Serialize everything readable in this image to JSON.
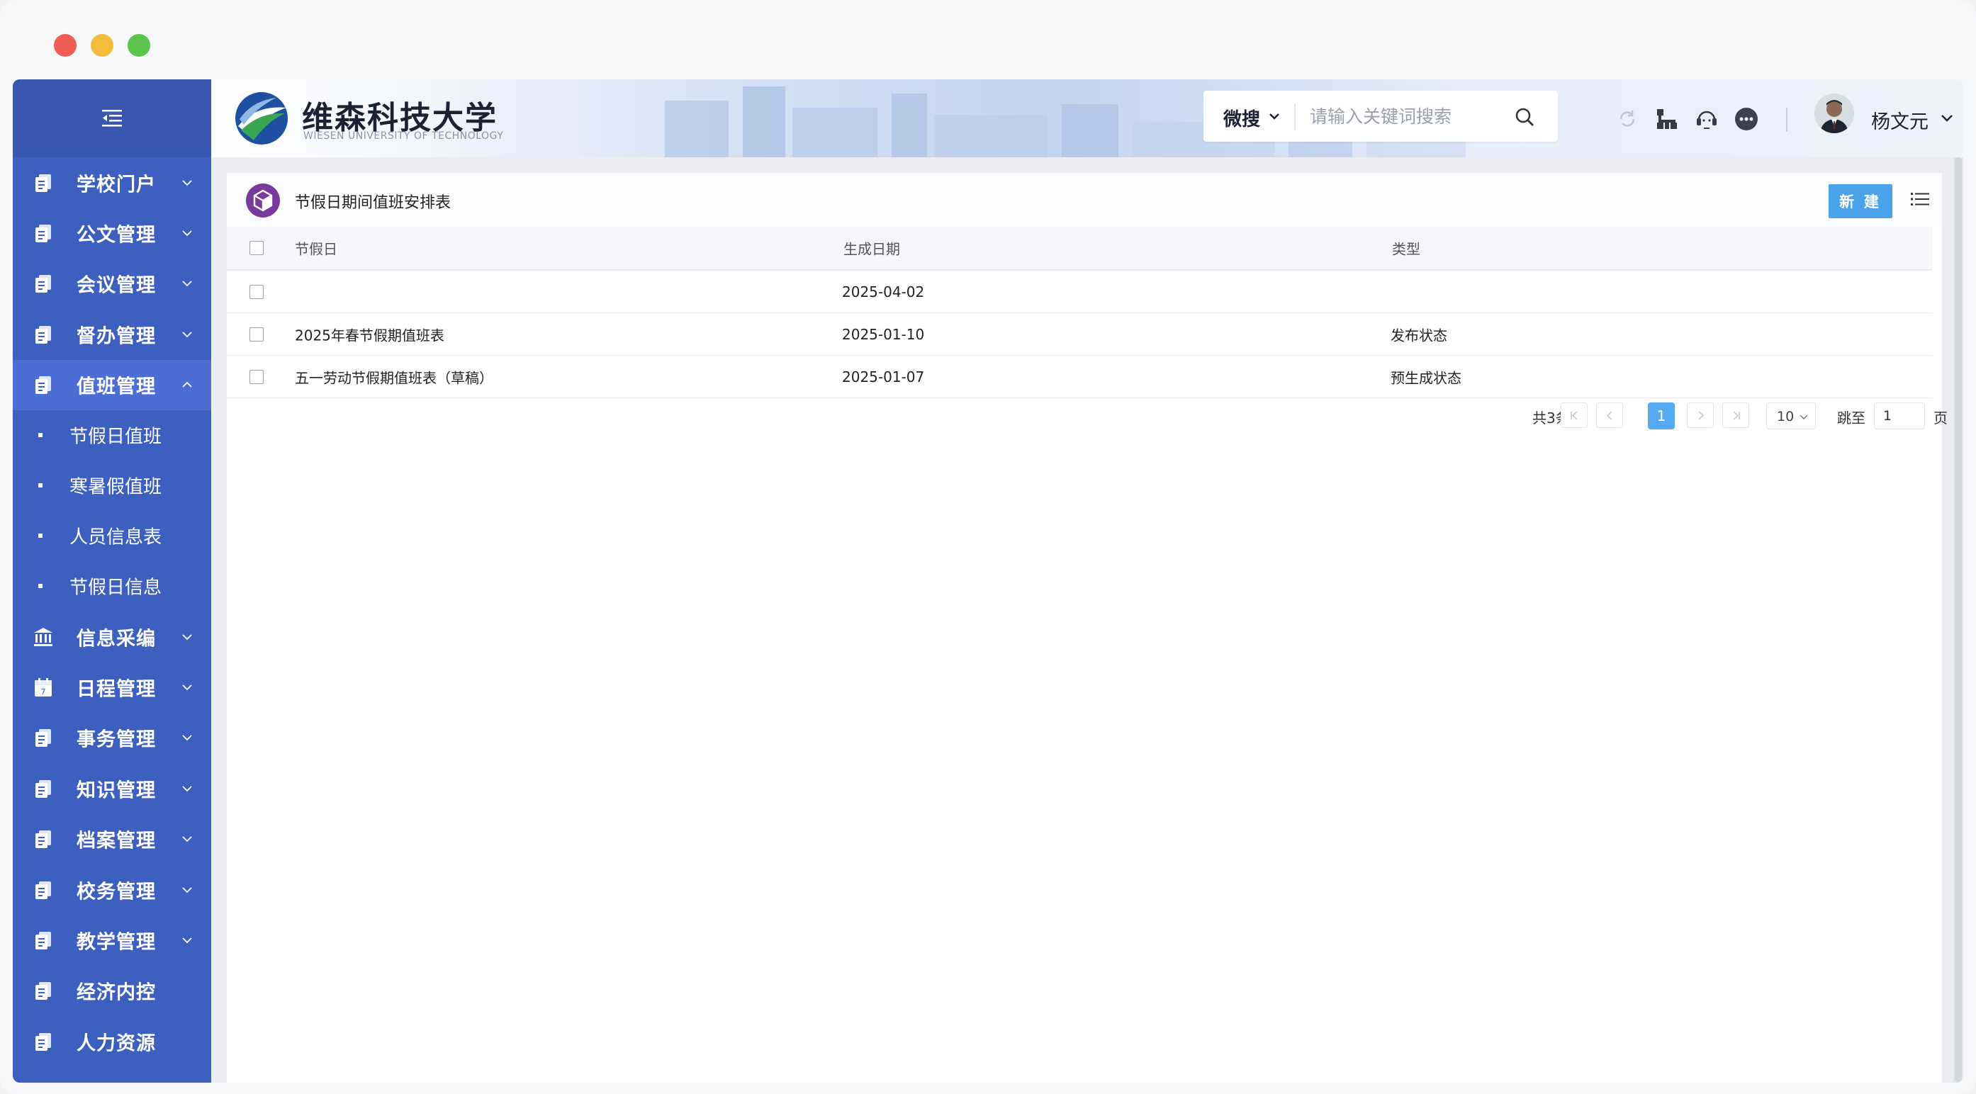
{
  "sidebar": {
    "collapse_icon": "menu-fold-icon",
    "items": [
      {
        "label": "学校门户",
        "icon": "document-icon",
        "expanded": false
      },
      {
        "label": "公文管理",
        "icon": "document-icon",
        "expanded": false
      },
      {
        "label": "会议管理",
        "icon": "document-icon",
        "expanded": false
      },
      {
        "label": "督办管理",
        "icon": "document-icon",
        "expanded": false
      },
      {
        "label": "值班管理",
        "icon": "document-icon",
        "expanded": true,
        "children": [
          "节假日值班",
          "寒暑假值班",
          "人员信息表",
          "节假日信息"
        ]
      },
      {
        "label": "信息采编",
        "icon": "bank-icon",
        "expanded": false
      },
      {
        "label": "日程管理",
        "icon": "calendar-icon",
        "expanded": false
      },
      {
        "label": "事务管理",
        "icon": "document-icon",
        "expanded": false
      },
      {
        "label": "知识管理",
        "icon": "document-icon",
        "expanded": false
      },
      {
        "label": "档案管理",
        "icon": "document-icon",
        "expanded": false
      },
      {
        "label": "校务管理",
        "icon": "document-icon",
        "expanded": false
      },
      {
        "label": "教学管理",
        "icon": "document-icon",
        "expanded": false
      },
      {
        "label": "经济内控",
        "icon": "document-icon",
        "expanded": false
      },
      {
        "label": "人力资源",
        "icon": "document-icon",
        "expanded": false
      }
    ]
  },
  "header": {
    "brand_cn": "维森科技大学",
    "brand_en": "WIESEN UNIVERSITY OF TECHNOLOGY",
    "search_scope": "微搜",
    "search_placeholder": "请输入关键词搜索",
    "user_name": "杨文元",
    "icons": [
      "refresh-icon",
      "org-chart-icon",
      "support-icon",
      "more-icon"
    ]
  },
  "panel": {
    "title": "节假日期间值班安排表",
    "new_button": "新 建",
    "columns": [
      "节假日",
      "生成日期",
      "类型"
    ],
    "rows": [
      {
        "name": "",
        "date": "2025-04-02",
        "type": ""
      },
      {
        "name": "2025年春节假期值班表",
        "date": "2025-01-10",
        "type": "发布状态"
      },
      {
        "name": "五一劳动节假期值班表（草稿）",
        "date": "2025-01-07",
        "type": "预生成状态"
      }
    ]
  },
  "pagination": {
    "total": "共3条",
    "current_page": "1",
    "page_size": "10",
    "jump_label": "跳至",
    "jump_value": "1",
    "page_suffix": "页"
  },
  "colors": {
    "sidebar_bg": "#3d5fbf",
    "sidebar_active": "#4c6ed4",
    "primary_button": "#4aa3ea",
    "active_page": "#55aaf0"
  }
}
